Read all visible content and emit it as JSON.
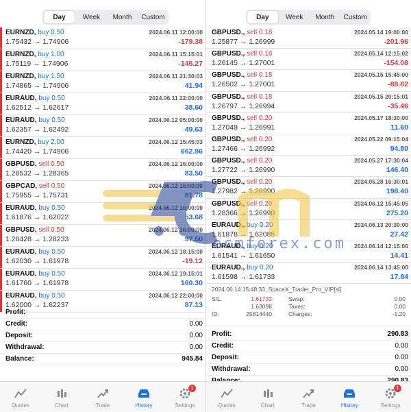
{
  "left": {
    "segments": [
      "Day",
      "Week",
      "Month",
      "Custom"
    ],
    "active_segment": "Day",
    "trades": [
      {
        "symbol": "EURNZD,",
        "side": "buy 0.50",
        "date": "2024.06.11 12:00:00",
        "open": "1.75432",
        "close": "1.74906",
        "profit": "-179.38",
        "dir": "buy",
        "pos": false
      },
      {
        "symbol": "EURNZD,",
        "side": "buy 1.00",
        "date": "2024.06.11 15:15:01",
        "open": "1.75119",
        "close": "1.74906",
        "profit": "-145.27",
        "dir": "buy",
        "pos": false
      },
      {
        "symbol": "EURNZD,",
        "side": "buy 1.50",
        "date": "2024.06.11 21:30:03",
        "open": "1.74865",
        "close": "1.74906",
        "profit": "41.94",
        "dir": "buy",
        "pos": true
      },
      {
        "symbol": "EURAUD,",
        "side": "buy 0.50",
        "date": "2024.06.11 22:00:00",
        "open": "1.62512",
        "close": "1.62617",
        "profit": "38.60",
        "dir": "buy",
        "pos": true
      },
      {
        "symbol": "EURAUD,",
        "side": "buy 0.50",
        "date": "2024.06.12 05:00:00",
        "open": "1.62357",
        "close": "1.62492",
        "profit": "49.63",
        "dir": "buy",
        "pos": true
      },
      {
        "symbol": "EURNZD,",
        "side": "buy 2.00",
        "date": "2024.06.12 15:45:03",
        "open": "1.74420",
        "close": "1.74906",
        "profit": "662.96",
        "dir": "buy",
        "pos": true
      },
      {
        "symbol": "GBPUSD,",
        "side": "sell 0.50",
        "date": "2024.06.12 16:00:00",
        "open": "1.28532",
        "close": "1.28365",
        "profit": "83.50",
        "dir": "sell",
        "pos": true
      },
      {
        "symbol": "GBPCAD,",
        "side": "sell 0.50",
        "date": "2024.06.12 16:00:00",
        "open": "1.75955",
        "close": "1.75731",
        "profit": "81.78",
        "dir": "sell",
        "pos": true
      },
      {
        "symbol": "EURAUD,",
        "side": "buy 0.50",
        "date": "2024.06.12 16:00:00",
        "open": "1.61876",
        "close": "1.62022",
        "profit": "53.68",
        "dir": "buy",
        "pos": true
      },
      {
        "symbol": "GBPUSD,",
        "side": "sell 0.50",
        "date": "2024.06.12 16:00:00",
        "open": "1.28428",
        "close": "1.28233",
        "profit": "97.50",
        "dir": "sell",
        "pos": true
      },
      {
        "symbol": "EURAUD,",
        "side": "buy 0.50",
        "date": "2024.06.12 18:15:00",
        "open": "1.62030",
        "close": "1.61978",
        "profit": "-19.12",
        "dir": "buy",
        "pos": false
      },
      {
        "symbol": "EURAUD,",
        "side": "buy 0.50",
        "date": "2024.06.12 19:15:01",
        "open": "1.61760",
        "close": "1.61978",
        "profit": "160.30",
        "dir": "buy",
        "pos": true
      },
      {
        "symbol": "EURAUD,",
        "side": "buy 0.50",
        "date": "2024.06.12 22:00:00",
        "open": "1.62000",
        "close": "1.62237",
        "profit": "87.13",
        "dir": "buy",
        "pos": true
      }
    ],
    "summary": [
      {
        "k": "Profit:",
        "v": ""
      },
      {
        "k": "Credit:",
        "v": "0.00"
      },
      {
        "k": "Deposit:",
        "v": "0.00"
      },
      {
        "k": "Withdrawal:",
        "v": "0.00"
      },
      {
        "k": "Balance:",
        "v": "945.84"
      }
    ]
  },
  "right": {
    "segments": [
      "Day",
      "Week",
      "Month",
      "Custom"
    ],
    "active_segment": "Day",
    "trades": [
      {
        "symbol": "GBPUSD.,",
        "side": "sell 0.18",
        "date": "2024.05.14 19:00:00",
        "open": "1.25877",
        "close": "1.26999",
        "profit": "-201.96",
        "dir": "sell",
        "pos": false
      },
      {
        "symbol": "GBPUSD.,",
        "side": "sell 0.18",
        "date": "2024.05.14 12:15:02",
        "open": "1.26145",
        "close": "1.27001",
        "profit": "-154.08",
        "dir": "sell",
        "pos": false
      },
      {
        "symbol": "GBPUSD.,",
        "side": "sell 0.18",
        "date": "2024.05.15 15:45:00",
        "open": "1.26502",
        "close": "1.27001",
        "profit": "-89.82",
        "dir": "sell",
        "pos": false
      },
      {
        "symbol": "GBPUSD.,",
        "side": "sell 0.18",
        "date": "2024.05.15 20:15:01",
        "open": "1.26797",
        "close": "1.26994",
        "profit": "-35.46",
        "dir": "sell",
        "pos": false
      },
      {
        "symbol": "GBPUSD.,",
        "side": "sell 0.20",
        "date": "2024.05.17 18:30:00",
        "open": "1.27049",
        "close": "1.26991",
        "profit": "11.60",
        "dir": "sell",
        "pos": true
      },
      {
        "symbol": "GBPUSD.,",
        "side": "sell 0.20",
        "date": "2024.05.22 09:15:04",
        "open": "1.27466",
        "close": "1.26992",
        "profit": "94.80",
        "dir": "sell",
        "pos": true
      },
      {
        "symbol": "GBPUSD.,",
        "side": "sell 0.20",
        "date": "2024.05.27 17:30:04",
        "open": "1.27722",
        "close": "1.26990",
        "profit": "146.40",
        "dir": "sell",
        "pos": true
      },
      {
        "symbol": "GBPUSD.,",
        "side": "sell 0.20",
        "date": "2024.05.28 16:30:01",
        "open": "1.27982",
        "close": "1.26990",
        "profit": "198.40",
        "dir": "sell",
        "pos": true
      },
      {
        "symbol": "GBPUSD.,",
        "side": "sell 0.20",
        "date": "2024.06.12 15:45:05",
        "open": "1.28366",
        "close": "1.26990",
        "profit": "275.20",
        "dir": "sell",
        "pos": true
      },
      {
        "symbol": "EURAUD.,",
        "side": "buy 0.20",
        "date": "2024.06.13 20:30:00",
        "open": "1.61878",
        "close": "1.62085",
        "profit": "27.42",
        "dir": "buy",
        "pos": true
      },
      {
        "symbol": "EURAUD.,",
        "side": "buy 0.20",
        "date": "2024.06.14 12:15:00",
        "open": "1.61541",
        "close": "1.61650",
        "profit": "14.41",
        "dir": "buy",
        "pos": true
      },
      {
        "symbol": "EURAUD.,",
        "side": "buy 0.20",
        "date": "2024.06.14 13:45:00",
        "open": "1.61598",
        "close": "1.61733",
        "profit": "17.84",
        "dir": "buy",
        "pos": true
      }
    ],
    "detail": {
      "header": "2024.06.14 15:48:33, SpaceX_Trader_Pro_VIP[sl]",
      "sl_label": "S/L:",
      "sl_value": "1.61733",
      "swap_label": "Swap:",
      "swap_value": "0.00",
      "tp_value": "1.63098",
      "taxes_label": "Taxes:",
      "taxes_value": "0.00",
      "id_label": "ID:",
      "id_value": "25814440",
      "charges_label": "Charges:",
      "charges_value": "-1.20"
    },
    "summary": [
      {
        "k": "Profit:",
        "v": "290.83"
      },
      {
        "k": "Credit:",
        "v": "0.00"
      },
      {
        "k": "Deposit:",
        "v": "0.00"
      },
      {
        "k": "Withdrawal:",
        "v": "0.00"
      },
      {
        "k": "Balance:",
        "v": "290.83"
      }
    ]
  },
  "tabs": [
    {
      "label": "Quotes",
      "icon": "quotes-icon"
    },
    {
      "label": "Chart",
      "icon": "chart-icon"
    },
    {
      "label": "Trade",
      "icon": "trade-icon"
    },
    {
      "label": "History",
      "icon": "history-icon"
    },
    {
      "label": "Settings",
      "icon": "settings-icon",
      "badge": "1"
    }
  ],
  "active_tab": "History",
  "watermark_text": "ecmforex.com",
  "colors": {
    "buy": "#1e6fd9",
    "sell": "#d23a3a",
    "accent": "#1e6fd9"
  }
}
